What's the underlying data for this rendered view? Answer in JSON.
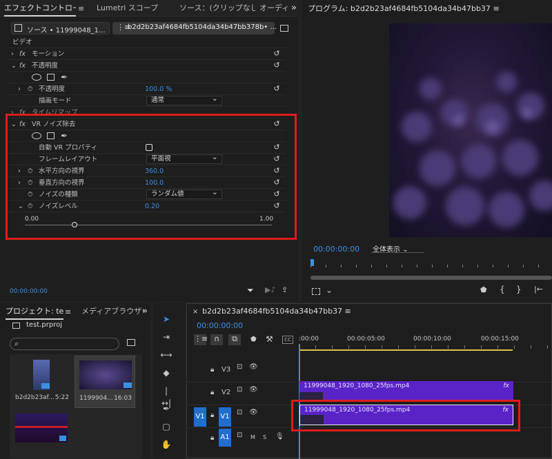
{
  "effect_controls": {
    "tabs": [
      "エフェクトコントロール",
      "Lumetri スコープ",
      "ソース：(クリップなし)",
      "オーディ"
    ],
    "more": "»",
    "source_label": "ソース • 11999048_1...",
    "sequence_label": "b2d2b23af4684fb5104da34b47bb378b• ...",
    "section": "ビデオ",
    "motion": "モーション",
    "opacity": "不透明度",
    "opacity_param": "不透明度",
    "opacity_value": "100.0 %",
    "blend_mode_label": "描画モード",
    "blend_mode_value": "通常",
    "time_remap": "タイムリマップ",
    "vr_effect": "VR ノイズ除去",
    "auto_vr": "自動 VR プロパティ",
    "frame_layout_label": "フレームレイアウト",
    "frame_layout_value": "平面視",
    "h_fov_label": "水平方向の視界",
    "h_fov_value": "360.0",
    "v_fov_label": "垂直方向の視界",
    "v_fov_value": "100.0",
    "noise_type_label": "ノイズの種類",
    "noise_type_value": "ランダム値",
    "noise_level_label": "ノイズレベル",
    "noise_level_value": "0.20",
    "slider_min": "0.00",
    "slider_max": "1.00",
    "timecode": "00:00:00:00",
    "fx": "fx"
  },
  "program": {
    "title": "プログラム: b2d2b23af4684fb5104da34b47bb37",
    "menu": "≡",
    "timecode": "00:00:00:00",
    "zoom": "全体表示"
  },
  "project": {
    "tabs": [
      "プロジェクト: tes",
      "メディアブラウザー"
    ],
    "file": "test.prproj",
    "items": [
      {
        "name": "b2d2b23af...",
        "duration": "5:22"
      },
      {
        "name": "1199904...",
        "duration": "16:03"
      }
    ]
  },
  "timeline": {
    "title": "b2d2b23af4684fb5104da34b47bb37",
    "timecode": "00:00:00:00",
    "ruler": [
      ":00:00",
      "00:00:05:00",
      "00:00:10:00",
      "00:00:15:00"
    ],
    "tracks": [
      "V3",
      "V2",
      "V1",
      "A1"
    ],
    "target_v1": "V1",
    "clip_v2": "11999048_1920_1080_25fps.mp4",
    "clip_v1": "11999048_1920_1080_25fps.mp4",
    "fx": "fx",
    "mute": "M",
    "solo": "S"
  },
  "colors": {
    "accent": "#3d8fe0",
    "clip": "#5a23c8",
    "highlight": "#e01c1c"
  },
  "opacity_percent": 100,
  "noise_level": 0.2
}
